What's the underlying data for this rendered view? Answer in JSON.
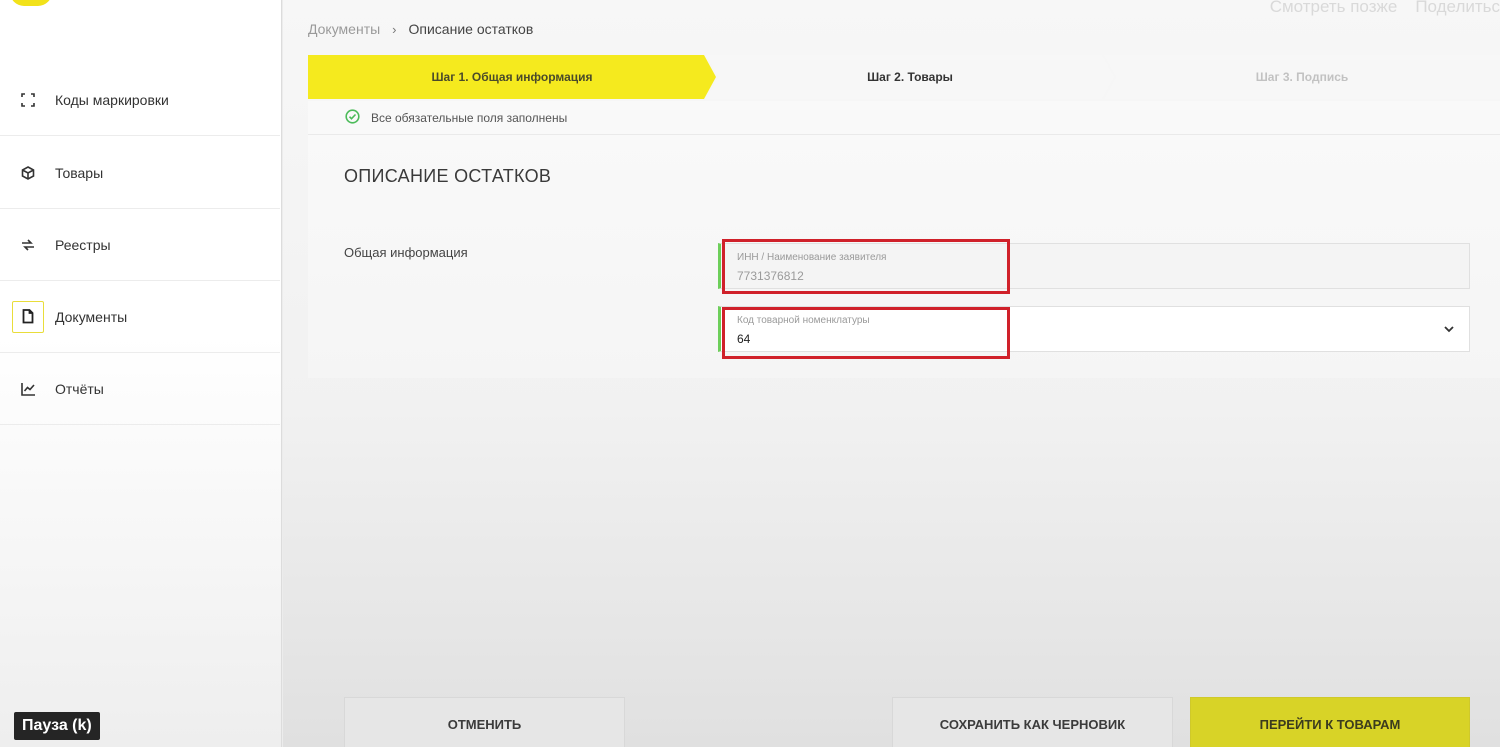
{
  "overlay": {
    "watch_later": "Смотреть позже",
    "share": "Поделитьс"
  },
  "sidebar": {
    "items": [
      {
        "label": "Коды маркировки",
        "icon": "scan-frame-icon"
      },
      {
        "label": "Товары",
        "icon": "box-icon"
      },
      {
        "label": "Реестры",
        "icon": "transfer-arrows-icon"
      },
      {
        "label": "Документы",
        "icon": "document-icon",
        "active": true
      },
      {
        "label": "Отчёты",
        "icon": "line-chart-icon"
      }
    ]
  },
  "breadcrumb": {
    "parent": "Документы",
    "separator": "›",
    "current": "Описание остатков"
  },
  "stepper": {
    "steps": [
      {
        "label": "Шаг 1. Общая информация",
        "state": "active"
      },
      {
        "label": "Шаг 2. Товары",
        "state": "next"
      },
      {
        "label": "Шаг 3. Подпись",
        "state": "disabled"
      }
    ]
  },
  "notice": {
    "text": "Все обязательные поля заполнены"
  },
  "form": {
    "title": "ОПИСАНИЕ ОСТАТКОВ",
    "section_label": "Общая информация",
    "inn_field": {
      "label": "ИНН / Наименование заявителя",
      "value": "7731376812"
    },
    "code_field": {
      "label": "Код товарной номенклатуры",
      "value": "64"
    }
  },
  "actions": {
    "cancel": "ОТМЕНИТЬ",
    "save_draft": "СОХРАНИТЬ КАК ЧЕРНОВИК",
    "next": "ПЕРЕЙТИ К ТОВАРАМ"
  },
  "player": {
    "pause_hint": "Пауза (k)"
  },
  "colors": {
    "accent_yellow": "#f5ea1e",
    "valid_green": "#6dcf5a",
    "highlight_red": "#d0212a"
  }
}
